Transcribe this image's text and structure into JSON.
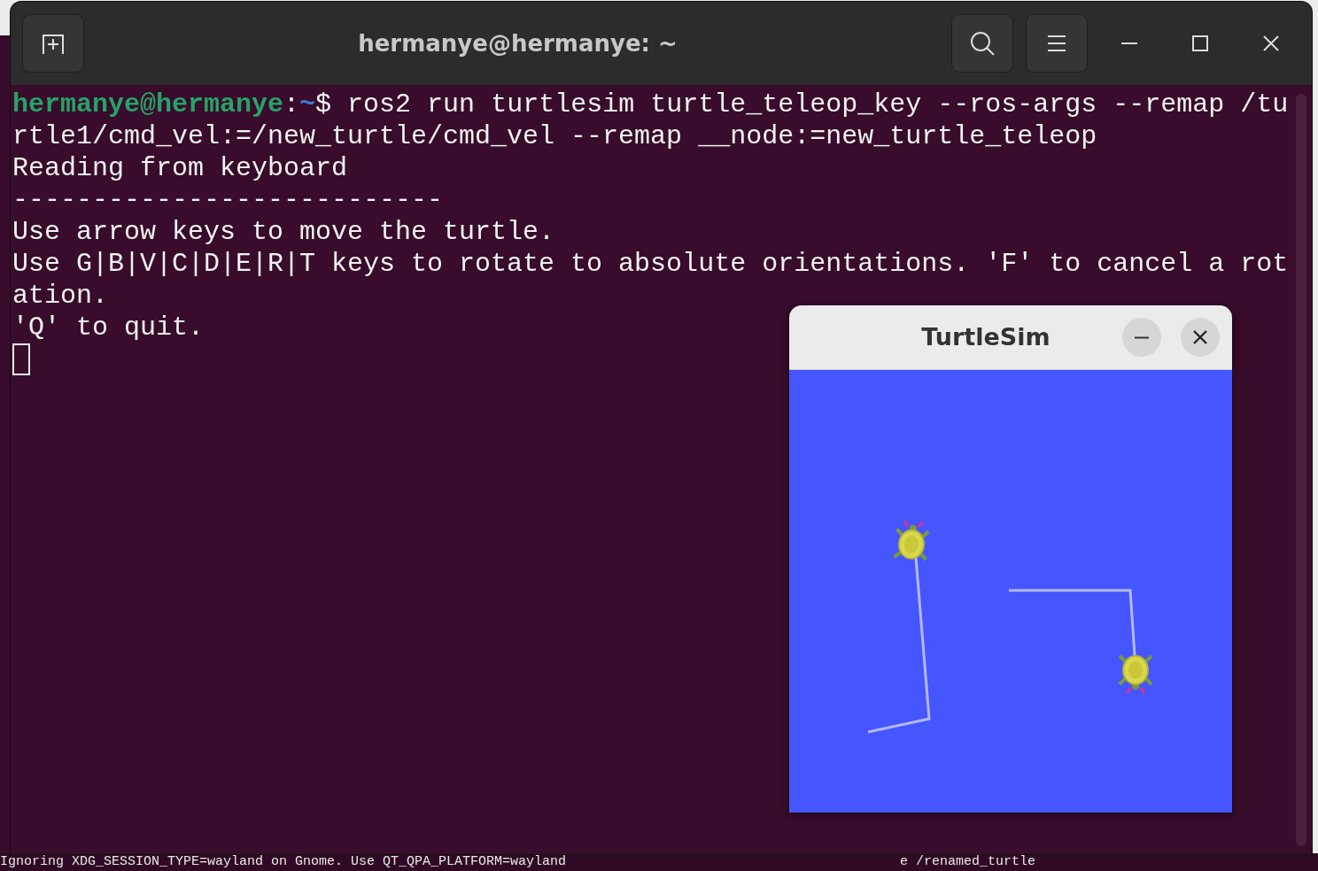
{
  "terminal": {
    "title": "hermanye@hermanye: ~",
    "lines": [
      {
        "kind": "prompt",
        "user_host": "hermanye@hermanye",
        "separator": ":",
        "path": "~",
        "symbol": "$",
        "command": "ros2 run turtlesim turtle_teleop_key --ros-args --remap /tu"
      },
      {
        "kind": "output",
        "text": "rtle1/cmd_vel:=/new_turtle/cmd_vel --remap __node:=new_turtle_teleop"
      },
      {
        "kind": "output",
        "text": "Reading from keyboard"
      },
      {
        "kind": "output",
        "text": "---------------------------"
      },
      {
        "kind": "output",
        "text": "Use arrow keys to move the turtle."
      },
      {
        "kind": "output",
        "text": "Use G|B|V|C|D|E|R|T keys to rotate to absolute orientations. 'F' to cancel a rot"
      },
      {
        "kind": "output",
        "text": "ation."
      },
      {
        "kind": "output",
        "text": "'Q' to quit."
      },
      {
        "kind": "cursor"
      }
    ]
  },
  "turtlesim": {
    "title": "TurtleSim"
  },
  "background": {
    "left_text": "Ignoring XDG_SESSION_TYPE=wayland on Gnome. Use QT_QPA_PLATFORM=wayland",
    "right_text": "e /renamed_turtle"
  }
}
